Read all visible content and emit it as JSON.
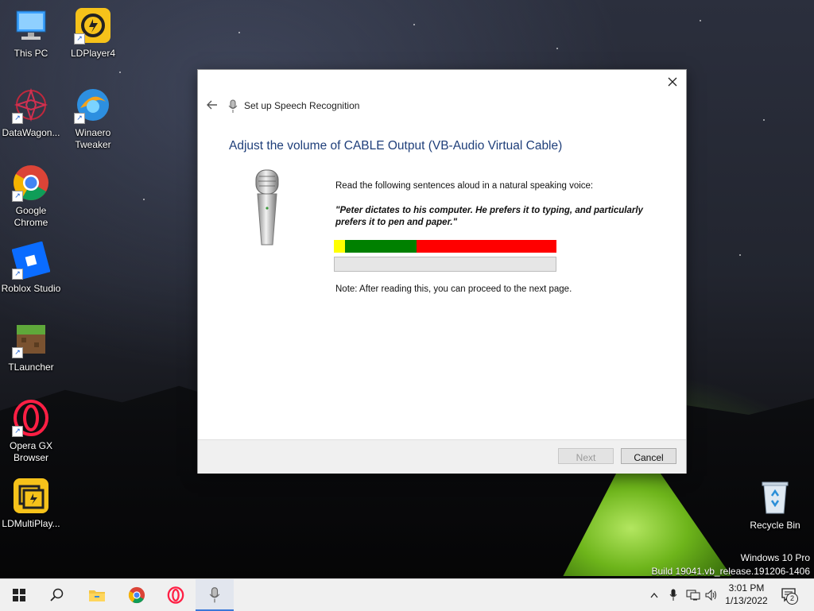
{
  "desktop": {
    "icons": [
      {
        "label": "This PC"
      },
      {
        "label": "LDPlayer4"
      },
      {
        "label": "DataWagon..."
      },
      {
        "label": "Winaero Tweaker"
      },
      {
        "label": "Google Chrome"
      },
      {
        "label": "Roblox Studio"
      },
      {
        "label": "TLauncher"
      },
      {
        "label": "Opera GX Browser"
      },
      {
        "label": "LDMultiPlay..."
      },
      {
        "label": "Recycle Bin"
      }
    ],
    "watermark": {
      "edition": "Windows 10 Pro",
      "build": "Build 19041.vb_release.191206-1406"
    }
  },
  "dialog": {
    "title": "Set up Speech Recognition",
    "heading": "Adjust the volume of CABLE Output (VB-Audio Virtual Cable)",
    "instruction": "Read the following sentences aloud in a natural speaking voice:",
    "quote": "\"Peter dictates to his computer. He prefers it to typing, and particularly prefers it to pen and paper.\"",
    "note": "Note: After reading this, you can proceed to the next page.",
    "volume_meter": {
      "colors": {
        "low": "#ffff00",
        "good": "#008000",
        "high": "#ff0000"
      },
      "zones": [
        0.05,
        0.32,
        0.63
      ]
    },
    "progress": 0,
    "buttons": {
      "next": "Next",
      "cancel": "Cancel"
    }
  },
  "taskbar": {
    "items": [
      "start-icon",
      "search-icon",
      "file-explorer-icon",
      "chrome-icon",
      "opera-icon",
      "speech-recognition-icon"
    ],
    "clock": {
      "time": "3:01 PM",
      "date": "1/13/2022"
    },
    "notification_count": "2"
  }
}
